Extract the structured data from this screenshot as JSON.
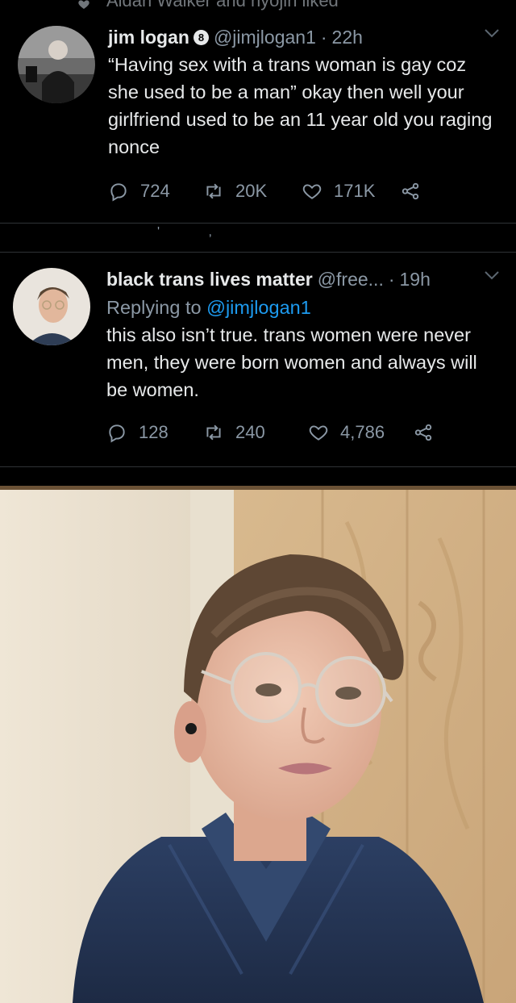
{
  "social_context": {
    "text": "Aidan Walker and nyojin liked",
    "icon": "heart-icon"
  },
  "tweets": [
    {
      "name": "jim logan",
      "badge": "8",
      "handle": "@jimjlogan1",
      "time": "22h",
      "replying_prefix": "",
      "replying_to": "",
      "text": "“Having sex with a trans woman is gay coz she used to be a man” okay then well your girlfriend used to be an 11 year old you raging nonce",
      "replies": "724",
      "retweets": "20K",
      "likes": "171K"
    },
    {
      "name": "black trans lives matter",
      "badge": "",
      "handle": "@free...",
      "time": "19h",
      "replying_prefix": "Replying to ",
      "replying_to": "@jimjlogan1",
      "text": "this also isn’t true. trans women were never men, they were born women and always will be women.",
      "replies": "128",
      "retweets": "240",
      "likes": "4,786"
    }
  ],
  "colors": {
    "background": "#000000",
    "text": "#e7e9ea",
    "secondary": "#8b98a5",
    "link": "#1d9bf0",
    "divider": "#2f3336"
  }
}
